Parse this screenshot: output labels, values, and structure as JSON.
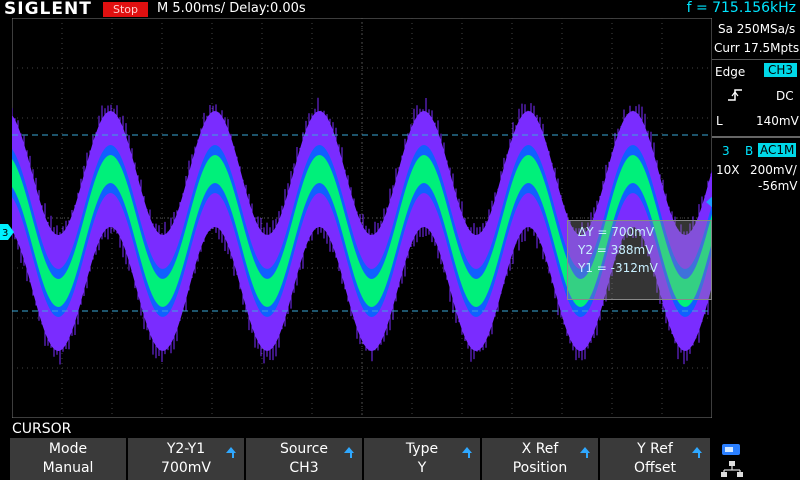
{
  "brand": "SIGLENT",
  "status": "Stop",
  "timebase": "M 5.00ms/ Delay:0.00s",
  "frequency": "f = 715.156kHz",
  "acquisition": {
    "sample_rate": "Sa 250MSa/s",
    "memory": "Curr 17.5Mpts"
  },
  "trigger": {
    "type": "Edge",
    "source": "CH3",
    "slope_icon": "rising-edge-icon",
    "coupling": "DC",
    "level_prefix": "L",
    "level": "140mV"
  },
  "channel": {
    "number": "3",
    "bw_flag": "B",
    "coupling": "AC1M",
    "probe": "10X",
    "scale": "200mV/",
    "offset": "-56mV"
  },
  "cursor_readout": {
    "delta": "ΔY = 700mV",
    "y2": "Y2 = 388mV",
    "y1": "Y1 = -312mV"
  },
  "menu_title": "CURSOR",
  "softkeys": [
    {
      "title": "Mode",
      "value": "Manual",
      "arrow": false
    },
    {
      "title": "Y2-Y1",
      "value": "700mV",
      "arrow": true
    },
    {
      "title": "Source",
      "value": "CH3",
      "arrow": true
    },
    {
      "title": "Type",
      "value": "Y",
      "arrow": true
    },
    {
      "title": "X Ref",
      "value": "Position",
      "arrow": true
    },
    {
      "title": "Y Ref",
      "value": "Offset",
      "arrow": true
    }
  ],
  "colors": {
    "trace_core": "#00f07a",
    "trace_mid": "#1060ff",
    "trace_outer": "#7a2cff",
    "cursor_line": "#3aa8d8",
    "accent": "#00e5ff"
  },
  "waveform": {
    "cycles": 6.7,
    "channel_marker": "3"
  }
}
